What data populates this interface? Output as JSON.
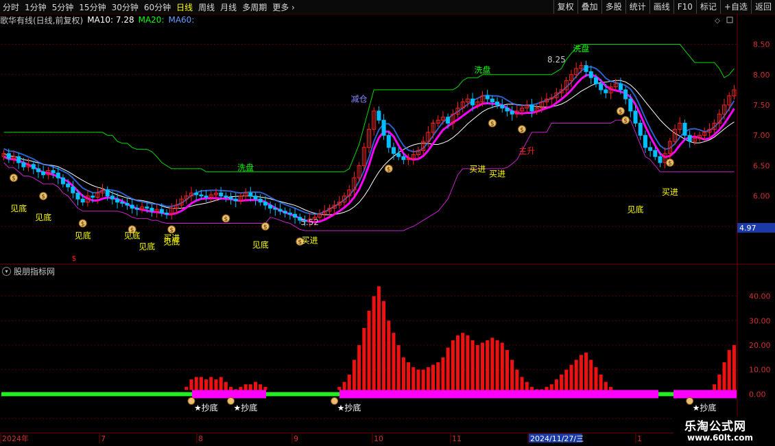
{
  "toolbar": {
    "left_items": [
      "分时",
      "1分钟",
      "5分钟",
      "15分钟",
      "30分钟",
      "60分钟",
      "日线",
      "周线",
      "月线",
      "多周期",
      "更多"
    ],
    "active": "日线",
    "right_items": [
      "复权",
      "叠加",
      "多股",
      "统计",
      "画线",
      "F10",
      "标记",
      "+自选",
      "返回"
    ]
  },
  "header": {
    "stock": "歌华有线(日线,前复权)",
    "ma10": "MA10: 7.28",
    "ma20": "MA20:",
    "ma60": "MA60:"
  },
  "sub_header": {
    "title": "股朋指标网"
  },
  "xaxis": {
    "labels": [
      "2024年",
      "7",
      "8",
      "9",
      "10",
      "11",
      "2024/11/27/三",
      "1"
    ]
  },
  "price_badge": "4.97",
  "watermark": {
    "line1": "乐淘公式网",
    "line2": "www.60lt.com"
  },
  "colors": {
    "up": "#ff2020",
    "down": "#00bfff",
    "ma": "#ffffff",
    "resist": "#00dd00",
    "support": "#cc22cc",
    "band": "#ff00ff"
  },
  "chart_data": [
    {
      "type": "candlestick",
      "title": "歌华有线(日线,前复权)",
      "ylim": [
        4.9,
        8.8
      ],
      "yticks": [
        8.5,
        8.0,
        7.5,
        7.0,
        6.5,
        6.0,
        5.5
      ],
      "closes": [
        6.7,
        6.62,
        6.65,
        6.55,
        6.48,
        6.52,
        6.45,
        6.4,
        6.35,
        6.42,
        6.38,
        6.3,
        6.2,
        6.15,
        6.05,
        5.95,
        5.9,
        6.0,
        5.98,
        6.05,
        6.1,
        6.0,
        5.95,
        5.9,
        5.88,
        5.85,
        5.8,
        5.78,
        5.82,
        5.8,
        5.75,
        5.78,
        5.72,
        5.7,
        5.8,
        5.85,
        5.95,
        6.0,
        6.05,
        6.02,
        6.0,
        5.98,
        6.02,
        6.05,
        6.0,
        5.98,
        5.95,
        5.92,
        6.0,
        6.05,
        6.0,
        5.95,
        5.9,
        5.85,
        5.8,
        5.78,
        5.75,
        5.72,
        5.7,
        5.65,
        5.6,
        5.58,
        5.62,
        5.65,
        5.7,
        5.75,
        5.8,
        5.85,
        5.9,
        6.0,
        6.1,
        6.3,
        6.5,
        6.8,
        7.1,
        7.4,
        7.25,
        7.0,
        6.8,
        6.7,
        6.65,
        6.6,
        6.62,
        6.68,
        6.75,
        6.9,
        7.05,
        7.2,
        7.25,
        7.3,
        7.2,
        7.35,
        7.45,
        7.55,
        7.6,
        7.5,
        7.55,
        7.65,
        7.6,
        7.55,
        7.5,
        7.45,
        7.4,
        7.35,
        7.4,
        7.45,
        7.5,
        7.4,
        7.45,
        7.55,
        7.6,
        7.62,
        7.7,
        7.75,
        7.9,
        8.0,
        8.1,
        8.15,
        8.05,
        7.95,
        7.85,
        7.75,
        7.7,
        7.8,
        7.85,
        7.75,
        7.6,
        7.4,
        7.2,
        7.0,
        6.8,
        6.75,
        6.65,
        6.55,
        6.7,
        6.9,
        7.1,
        7.2,
        7.0,
        6.9,
        6.95,
        7.0,
        7.05,
        7.1,
        7.2,
        7.35,
        7.5,
        7.65,
        7.75
      ],
      "annotations": [
        {
          "text": "见底",
          "i": 3,
          "y": 5.75,
          "color": "#ffff00"
        },
        {
          "text": "见底",
          "i": 8,
          "y": 5.6,
          "color": "#ffff00"
        },
        {
          "text": "见底",
          "i": 16,
          "y": 5.3,
          "color": "#ffff00"
        },
        {
          "text": "见底",
          "i": 26,
          "y": 5.3,
          "color": "#ffff00"
        },
        {
          "text": "见底",
          "i": 29,
          "y": 5.12,
          "color": "#ffff00"
        },
        {
          "text": "见底",
          "i": 34,
          "y": 5.2,
          "color": "#ffff00"
        },
        {
          "text": "买进",
          "i": 34,
          "y": 5.26,
          "color": "#ffff00"
        },
        {
          "text": "见底",
          "i": 52,
          "y": 5.15,
          "color": "#ffff00"
        },
        {
          "text": "买进",
          "i": 62,
          "y": 5.22,
          "color": "#ffff00"
        },
        {
          "text": "洗盘",
          "i": 49,
          "y": 6.42,
          "color": "#00ff00"
        },
        {
          "text": "减仓",
          "i": 72,
          "y": 7.55,
          "color": "#8888ff"
        },
        {
          "text": "洗盘",
          "i": 97,
          "y": 8.03,
          "color": "#00ff00"
        },
        {
          "text": "买进",
          "i": 96,
          "y": 6.4,
          "color": "#ffff00"
        },
        {
          "text": "买进",
          "i": 100,
          "y": 6.32,
          "color": "#ffff00"
        },
        {
          "text": "主升",
          "i": 106,
          "y": 6.7,
          "color": "#ff2020"
        },
        {
          "text": "洗盘",
          "i": 117,
          "y": 8.38,
          "color": "#00ff00"
        },
        {
          "text": "见底",
          "i": 128,
          "y": 5.73,
          "color": "#ffff00"
        },
        {
          "text": "买进",
          "i": 135,
          "y": 6.02,
          "color": "#ffff00"
        },
        {
          "text": "5.52",
          "i": 62,
          "y": 5.52,
          "color": "#c8c8c8"
        },
        {
          "text": "8.25",
          "i": 112,
          "y": 8.2,
          "color": "#c8c8c8"
        }
      ],
      "bag_markers": [
        2,
        8,
        16,
        26,
        34,
        45,
        53,
        60,
        78,
        99,
        105,
        125,
        126,
        135
      ]
    },
    {
      "type": "bar",
      "title": "股朋指标网",
      "ylim": [
        -15,
        48
      ],
      "yticks": [
        40.0,
        30.0,
        20.0,
        10.0,
        0.0,
        -10.0
      ],
      "values": [
        0,
        0,
        0,
        0,
        0,
        0,
        0,
        0,
        0,
        0,
        0,
        0,
        0,
        0,
        0,
        0,
        0,
        0,
        0,
        0,
        0,
        0,
        0,
        0,
        0,
        0,
        0,
        0,
        0,
        0,
        0,
        0,
        0,
        0,
        0,
        0,
        0,
        3,
        6,
        7,
        7,
        6,
        7,
        6,
        7,
        5,
        3,
        2,
        3,
        4,
        4,
        5,
        4,
        3,
        0,
        0,
        0,
        0,
        0,
        0,
        0,
        0,
        0,
        0,
        0,
        0,
        0,
        0,
        3,
        5,
        8,
        14,
        20,
        27,
        34,
        40,
        44,
        38,
        30,
        25,
        20,
        15,
        13,
        11,
        10,
        10,
        11,
        12,
        13,
        15,
        19,
        22,
        24,
        25,
        24,
        22,
        20,
        21,
        22,
        23,
        22,
        21,
        18,
        14,
        10,
        7,
        5,
        3,
        2,
        2,
        3,
        4,
        6,
        8,
        10,
        12,
        14,
        16,
        17,
        14,
        11,
        8,
        5,
        3,
        0,
        0,
        0,
        0,
        0,
        0,
        0,
        0,
        0,
        0,
        0,
        0,
        0,
        0,
        0,
        0,
        0,
        0,
        0,
        0,
        4,
        8,
        13,
        18,
        20
      ],
      "labels": [
        {
          "text": "★抄底",
          "i": 38
        },
        {
          "text": "★抄底",
          "i": 46
        },
        {
          "text": "★抄底",
          "i": 67
        },
        {
          "text": "★抄底",
          "i": 139
        }
      ]
    }
  ]
}
